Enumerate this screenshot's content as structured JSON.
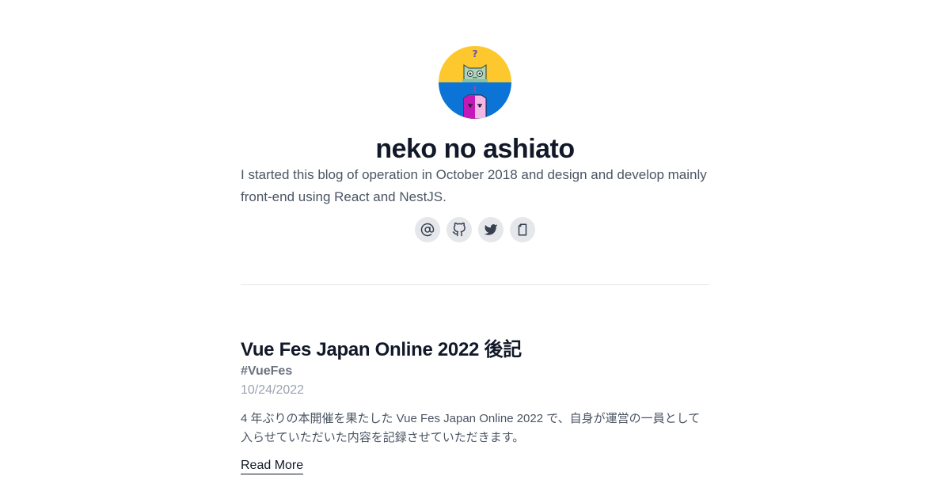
{
  "profile": {
    "title": "neko no ashiato",
    "description": "I started this blog of operation in October 2018 and design and develop mainly front-end using React and NestJS.",
    "avatar_icon": "cat-avatar-icon",
    "avatar_colors": {
      "top": "#fcc82d",
      "bottom": "#0b74d6"
    }
  },
  "socials": [
    {
      "name": "email-icon",
      "glyph": "@"
    },
    {
      "name": "github-icon",
      "glyph": "github"
    },
    {
      "name": "twitter-icon",
      "glyph": "twitter"
    },
    {
      "name": "document-icon",
      "glyph": "doc"
    }
  ],
  "post": {
    "title": "Vue Fes Japan Online 2022 後記",
    "tag": "#VueFes",
    "date": "10/24/2022",
    "excerpt": "4 年ぶりの本開催を果たした Vue Fes Japan Online 2022 で、自身が運営の一員として入らせていただいた内容を記録させていただきます。",
    "read_more": "Read More"
  }
}
